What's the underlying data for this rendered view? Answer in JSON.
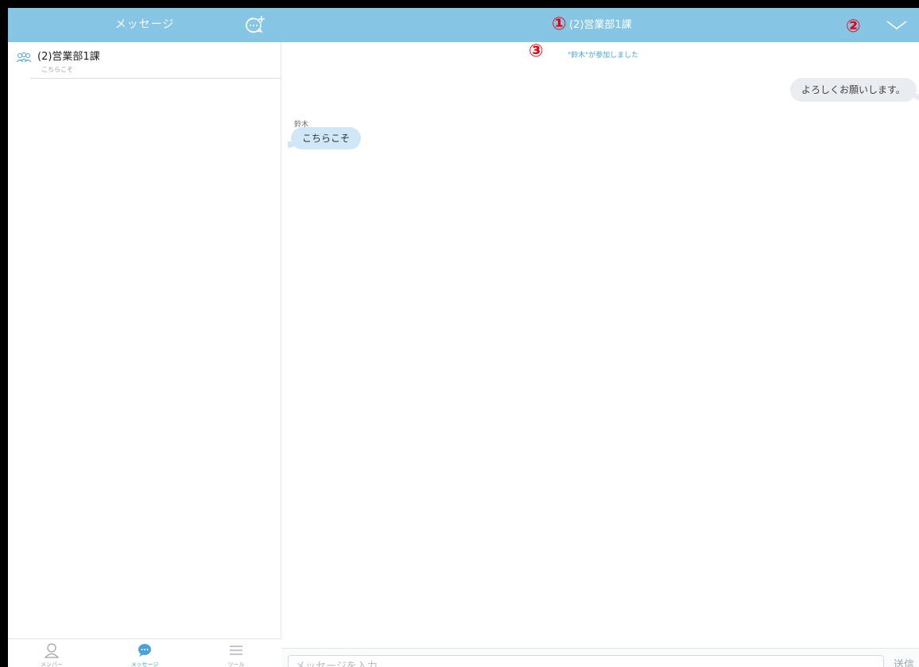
{
  "sidebar": {
    "title": "メッセージ",
    "conversations": [
      {
        "title": "(2)営業部1課",
        "preview": "こちらこそ"
      }
    ],
    "tabs": [
      {
        "label": "メンバー",
        "icon": "person-icon",
        "active": false
      },
      {
        "label": "メッセージ",
        "icon": "chat-bubble-icon",
        "active": true
      },
      {
        "label": "ツール",
        "icon": "menu-lines-icon",
        "active": false
      }
    ]
  },
  "chat": {
    "title": "(2)営業部1課",
    "system_message": "\"鈴木\"が参加しました",
    "messages": [
      {
        "direction": "outgoing",
        "text": "よろしくお願いします。"
      },
      {
        "direction": "incoming",
        "sender": "鈴木",
        "text": "こちらこそ"
      }
    ],
    "input_placeholder": "メッセージを入力",
    "send_label": "送信"
  },
  "annotations": {
    "marker_1": "①",
    "marker_2": "②",
    "marker_3": "③",
    "color": "#e60012"
  },
  "colors": {
    "header": "#86c5e4",
    "accent": "#4aa3d6",
    "incoming_bubble": "#cfe7f6",
    "outgoing_bubble": "#e9ecf1"
  }
}
